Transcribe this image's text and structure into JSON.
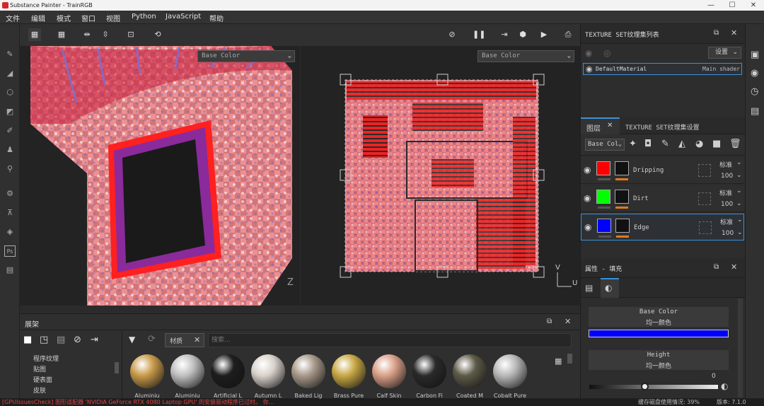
{
  "window": {
    "title": "Substance Painter - TrainRGB",
    "min": "—",
    "max": "☐",
    "close": "✕"
  },
  "menu": [
    "文件",
    "编辑",
    "模式",
    "窗口",
    "视图",
    "Python",
    "JavaScript",
    "帮助"
  ],
  "viewport": {
    "left_channel": "Base Color",
    "right_channel": "Base Color",
    "axis_y": "V",
    "axis_x": "U",
    "axis_z": "Z"
  },
  "texture_set_list": {
    "title": "TEXTURE SET纹理集列表",
    "settings_label": "设置",
    "material_name": "DefaultMaterial",
    "shader": "Main shader"
  },
  "layers_panel": {
    "tab_layers": "图层",
    "tab_texture_settings": "TEXTURE SET纹理集设置",
    "channel": "Base Col",
    "items": [
      {
        "name": "Dripping",
        "blend": "标准",
        "opacity": "100",
        "color": "#ff0000"
      },
      {
        "name": "Dirt",
        "blend": "标准",
        "opacity": "100",
        "color": "#00ff00"
      },
      {
        "name": "Edge",
        "blend": "标准",
        "opacity": "100",
        "color": "#0000ff"
      }
    ]
  },
  "properties": {
    "title": "属性 - 填充",
    "base_color_label": "Base Color",
    "base_color_mode": "均一颜色",
    "base_color_value": "#0000ff",
    "height_label": "Height",
    "height_mode": "均一颜色",
    "height_value": "0",
    "height_level": 0.36
  },
  "shelf": {
    "title": "展架",
    "categories": [
      "程序纹理",
      "贴图",
      "硬表面",
      "皮肤"
    ],
    "filter_tag": "材质",
    "search_placeholder": "搜索...",
    "materials": [
      {
        "name": "Aluminiu",
        "color": "#c89a4a"
      },
      {
        "name": "Aluminiu",
        "color": "#c0c0c0"
      },
      {
        "name": "Artificial L",
        "color": "#1e1e1e"
      },
      {
        "name": "Autumn L",
        "color": "#d9d2cb"
      },
      {
        "name": "Baked Lig",
        "color": "#a8998a"
      },
      {
        "name": "Brass Pure",
        "color": "#c8a844"
      },
      {
        "name": "Calf Skin",
        "color": "#d9a088"
      },
      {
        "name": "Carbon Fi",
        "color": "#2a2a2a"
      },
      {
        "name": "Coated M",
        "color": "#5e5a48"
      },
      {
        "name": "Cobalt Pure",
        "color": "#b8b8b8"
      }
    ]
  },
  "status": {
    "message": "[GPUIssuesCheck] 图形适配器 'NVIDIA GeForce RTX 4080 Laptop GPU' 的安装驱动程序已过时。 你...",
    "disk": "缓存磁盘使用情况: 39%",
    "version": "版本: 7.1.0"
  }
}
